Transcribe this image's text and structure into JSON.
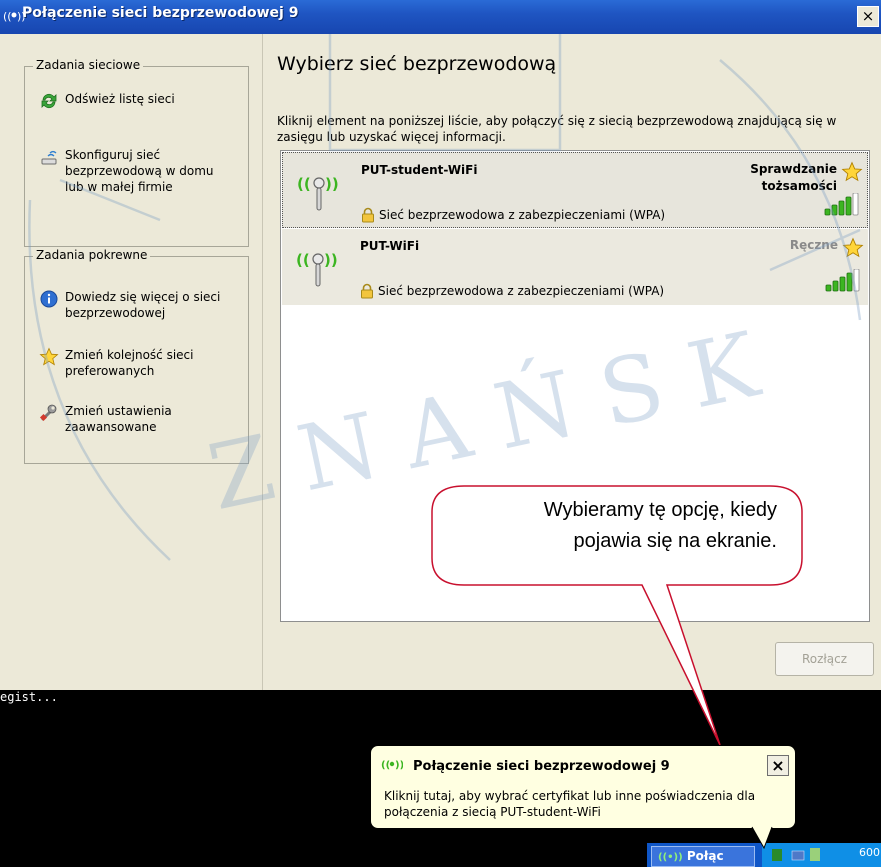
{
  "window": {
    "title": "Połączenie sieci bezprzewodowej 9",
    "close_label": "×"
  },
  "left_pane": {
    "network_tasks": {
      "title": "Zadania sieciowe",
      "items": [
        {
          "label": "Odśwież listę sieci",
          "icon": "refresh-icon"
        },
        {
          "label": "Skonfiguruj sieć\nbezprzewodową w domu\nlub w małej firmie",
          "icon": "wireless-setup-icon"
        }
      ]
    },
    "related_tasks": {
      "title": "Zadania pokrewne",
      "items": [
        {
          "label": "Dowiedz się więcej o sieci\nbezprzewodowej",
          "icon": "info-icon"
        },
        {
          "label": "Zmień kolejność sieci\npreferowanych",
          "icon": "star-icon"
        },
        {
          "label": "Zmień ustawienia\nzaawansowane",
          "icon": "wrench-icon"
        }
      ]
    }
  },
  "main": {
    "heading": "Wybierz sieć bezprzewodową",
    "description": "Kliknij element na poniższej liście, aby połączyć się z siecią bezprzewodową znajdującą się w zasięgu lub uzyskać więcej informacji.",
    "networks": [
      {
        "name": "PUT-student-WiFi",
        "status_line1": "Sprawdzanie",
        "status_line2": "tożsamości",
        "security": "Sieć bezprzewodowa z zabezpieczeniami (WPA)",
        "selected": true,
        "signal": 0.8
      },
      {
        "name": "PUT-WiFi",
        "status_line1": "Ręczne",
        "status_line2": "",
        "security": "Sieć bezprzewodowa z zabezpieczeniami (WPA)",
        "selected": false,
        "signal": 0.8
      }
    ],
    "disconnect_label": "Rozłącz"
  },
  "console": {
    "text": "egist..."
  },
  "callout": {
    "text": "Wybieramy tę opcję, kiedy\npojawia się na ekranie."
  },
  "balloon": {
    "title": "Połączenie sieci bezprzewodowej 9",
    "close_label": "×",
    "text": "Kliknij tutaj, aby wybrać certyfikat lub inne poświadczenia dla\npołączenia z siecią PUT-student-WiFi"
  },
  "taskbar": {
    "button_label": "Połąc",
    "tray_text": "600"
  },
  "colors": {
    "titlebar": "#1f55c2",
    "pane_bg": "#ece9d8",
    "signal_green": "#3cb521",
    "callout_border": "#c8102e",
    "balloon_bg": "#ffffe1",
    "taskbar": "#0f56c8",
    "watermark": "#7a9dc4"
  }
}
